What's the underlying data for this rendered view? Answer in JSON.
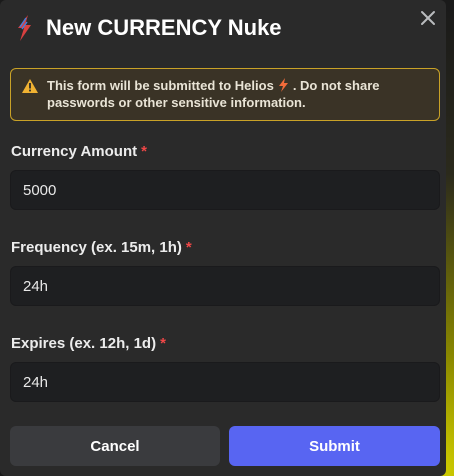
{
  "modal": {
    "title": "New CURRENCY Nuke",
    "close_icon": "close-icon",
    "logo_icon": "helios-logo-icon"
  },
  "warning": {
    "icon": "warning-triangle-icon",
    "text_before": "This form will be submitted to",
    "app_name": "Helios",
    "app_icon": "lightning-bolt-icon",
    "text_after": ". Do not share passwords or other sensitive information.",
    "border_color": "#c9a227"
  },
  "fields": [
    {
      "label": "Currency Amount",
      "required_mark": "*",
      "value": "5000"
    },
    {
      "label": "Frequency (ex. 15m, 1h)",
      "required_mark": "*",
      "value": "24h"
    },
    {
      "label": "Expires (ex. 12h, 1d)",
      "required_mark": "*",
      "value": "24h"
    }
  ],
  "buttons": {
    "cancel_label": "Cancel",
    "submit_label": "Submit",
    "submit_color": "#5865f2"
  }
}
